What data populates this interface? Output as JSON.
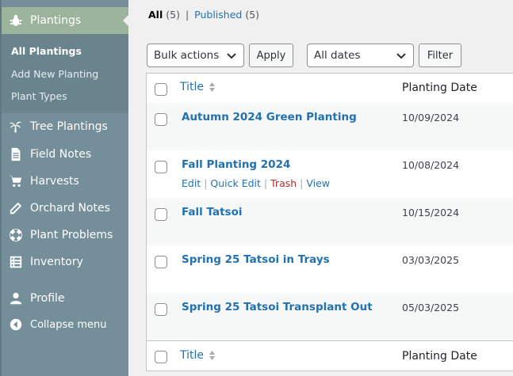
{
  "sidebar": {
    "active_menu": "Plantings",
    "submenu": [
      "All Plantings",
      "Add New Planting",
      "Plant Types"
    ],
    "items": [
      "Tree Plantings",
      "Field Notes",
      "Harvests",
      "Orchard Notes",
      "Plant Problems",
      "Inventory"
    ],
    "profile": "Profile",
    "collapse": "Collapse menu"
  },
  "views": {
    "all_label": "All",
    "all_count": "(5)",
    "separator": "|",
    "published_label": "Published",
    "published_count": "(5)"
  },
  "toolbar": {
    "bulk_actions": "Bulk actions",
    "apply": "Apply",
    "dates": "All dates",
    "filter": "Filter"
  },
  "table": {
    "columns": [
      "Title",
      "Planting Date"
    ],
    "rows": [
      {
        "title": "Autumn 2024 Green Planting",
        "date": "10/09/2024"
      },
      {
        "title": "Fall Planting 2024",
        "date": "10/08/2024"
      },
      {
        "title": "Fall Tatsoi",
        "date": "10/15/2024"
      },
      {
        "title": "Spring 25 Tatsoi in Trays",
        "date": "03/03/2025"
      },
      {
        "title": "Spring 25 Tatsoi Transplant Out",
        "date": "05/03/2025"
      }
    ],
    "row_actions": [
      "Edit",
      "Quick Edit",
      "Trash",
      "View"
    ],
    "row_action_separator": "|"
  },
  "colors": {
    "sidebar_bg": "#748f99",
    "active_menu_bg": "#9cb39c",
    "link": "#2271b1",
    "trash": "#b32d2e"
  }
}
